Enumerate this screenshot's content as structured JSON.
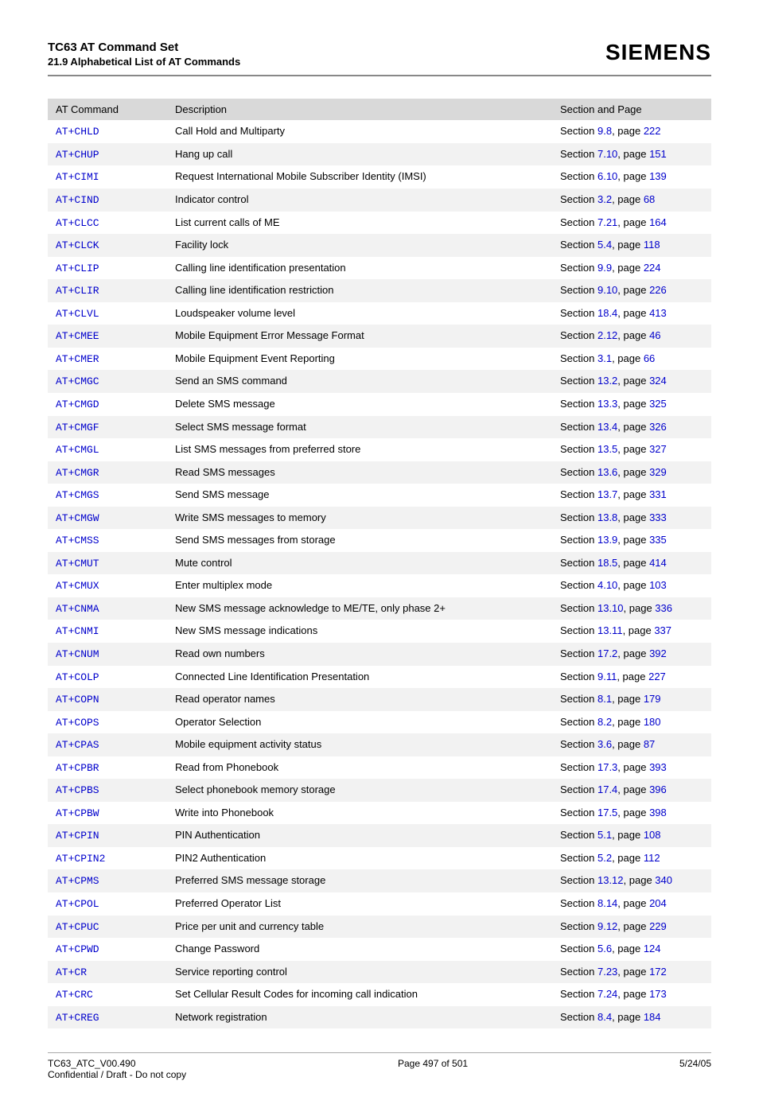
{
  "header": {
    "title": "TC63 AT Command Set",
    "subtitle": "21.9 Alphabetical List of AT Commands",
    "logo": "SIEMENS"
  },
  "table": {
    "headers": {
      "cmd": "AT Command",
      "desc": "Description",
      "sec": "Section and Page"
    },
    "rows": [
      {
        "cmd": "AT+CHLD",
        "desc": "Call Hold and Multiparty",
        "sec_num": "9.8",
        "page": "222"
      },
      {
        "cmd": "AT+CHUP",
        "desc": "Hang up call",
        "sec_num": "7.10",
        "page": "151"
      },
      {
        "cmd": "AT+CIMI",
        "desc": "Request International Mobile Subscriber Identity (IMSI)",
        "sec_num": "6.10",
        "page": "139"
      },
      {
        "cmd": "AT+CIND",
        "desc": "Indicator control",
        "sec_num": "3.2",
        "page": "68"
      },
      {
        "cmd": "AT+CLCC",
        "desc": "List current calls of ME",
        "sec_num": "7.21",
        "page": "164"
      },
      {
        "cmd": "AT+CLCK",
        "desc": "Facility lock",
        "sec_num": "5.4",
        "page": "118"
      },
      {
        "cmd": "AT+CLIP",
        "desc": "Calling line identification presentation",
        "sec_num": "9.9",
        "page": "224"
      },
      {
        "cmd": "AT+CLIR",
        "desc": "Calling line identification restriction",
        "sec_num": "9.10",
        "page": "226"
      },
      {
        "cmd": "AT+CLVL",
        "desc": "Loudspeaker volume level",
        "sec_num": "18.4",
        "page": "413"
      },
      {
        "cmd": "AT+CMEE",
        "desc": "Mobile Equipment Error Message Format",
        "sec_num": "2.12",
        "page": "46"
      },
      {
        "cmd": "AT+CMER",
        "desc": "Mobile Equipment Event Reporting",
        "sec_num": "3.1",
        "page": "66"
      },
      {
        "cmd": "AT+CMGC",
        "desc": "Send an SMS command",
        "sec_num": "13.2",
        "page": "324"
      },
      {
        "cmd": "AT+CMGD",
        "desc": "Delete SMS message",
        "sec_num": "13.3",
        "page": "325"
      },
      {
        "cmd": "AT+CMGF",
        "desc": "Select SMS message format",
        "sec_num": "13.4",
        "page": "326"
      },
      {
        "cmd": "AT+CMGL",
        "desc": "List SMS messages from preferred store",
        "sec_num": "13.5",
        "page": "327"
      },
      {
        "cmd": "AT+CMGR",
        "desc": "Read SMS messages",
        "sec_num": "13.6",
        "page": "329"
      },
      {
        "cmd": "AT+CMGS",
        "desc": "Send SMS message",
        "sec_num": "13.7",
        "page": "331"
      },
      {
        "cmd": "AT+CMGW",
        "desc": "Write SMS messages to memory",
        "sec_num": "13.8",
        "page": "333"
      },
      {
        "cmd": "AT+CMSS",
        "desc": "Send SMS messages from storage",
        "sec_num": "13.9",
        "page": "335"
      },
      {
        "cmd": "AT+CMUT",
        "desc": "Mute control",
        "sec_num": "18.5",
        "page": "414"
      },
      {
        "cmd": "AT+CMUX",
        "desc": "Enter multiplex mode",
        "sec_num": "4.10",
        "page": "103"
      },
      {
        "cmd": "AT+CNMA",
        "desc": "New SMS message acknowledge to ME/TE, only phase 2+",
        "sec_num": "13.10",
        "page": "336"
      },
      {
        "cmd": "AT+CNMI",
        "desc": "New SMS message indications",
        "sec_num": "13.11",
        "page": "337"
      },
      {
        "cmd": "AT+CNUM",
        "desc": "Read own numbers",
        "sec_num": "17.2",
        "page": "392"
      },
      {
        "cmd": "AT+COLP",
        "desc": "Connected Line Identification Presentation",
        "sec_num": "9.11",
        "page": "227"
      },
      {
        "cmd": "AT+COPN",
        "desc": "Read operator names",
        "sec_num": "8.1",
        "page": "179"
      },
      {
        "cmd": "AT+COPS",
        "desc": "Operator Selection",
        "sec_num": "8.2",
        "page": "180"
      },
      {
        "cmd": "AT+CPAS",
        "desc": "Mobile equipment activity status",
        "sec_num": "3.6",
        "page": "87"
      },
      {
        "cmd": "AT+CPBR",
        "desc": "Read from Phonebook",
        "sec_num": "17.3",
        "page": "393"
      },
      {
        "cmd": "AT+CPBS",
        "desc": "Select phonebook memory storage",
        "sec_num": "17.4",
        "page": "396"
      },
      {
        "cmd": "AT+CPBW",
        "desc": "Write into Phonebook",
        "sec_num": "17.5",
        "page": "398"
      },
      {
        "cmd": "AT+CPIN",
        "desc": "PIN Authentication",
        "sec_num": "5.1",
        "page": "108"
      },
      {
        "cmd": "AT+CPIN2",
        "desc": "PIN2 Authentication",
        "sec_num": "5.2",
        "page": "112"
      },
      {
        "cmd": "AT+CPMS",
        "desc": "Preferred SMS message storage",
        "sec_num": "13.12",
        "page": "340"
      },
      {
        "cmd": "AT+CPOL",
        "desc": "Preferred Operator List",
        "sec_num": "8.14",
        "page": "204"
      },
      {
        "cmd": "AT+CPUC",
        "desc": "Price per unit and currency table",
        "sec_num": "9.12",
        "page": "229"
      },
      {
        "cmd": "AT+CPWD",
        "desc": "Change Password",
        "sec_num": "5.6",
        "page": "124"
      },
      {
        "cmd": "AT+CR",
        "desc": "Service reporting control",
        "sec_num": "7.23",
        "page": "172"
      },
      {
        "cmd": "AT+CRC",
        "desc": "Set Cellular Result Codes for incoming call indication",
        "sec_num": "7.24",
        "page": "173"
      },
      {
        "cmd": "AT+CREG",
        "desc": "Network registration",
        "sec_num": "8.4",
        "page": "184"
      }
    ]
  },
  "footer": {
    "left_line1": "TC63_ATC_V00.490",
    "left_line2": "Confidential / Draft - Do not copy",
    "center": "Page 497 of 501",
    "right": "5/24/05"
  }
}
